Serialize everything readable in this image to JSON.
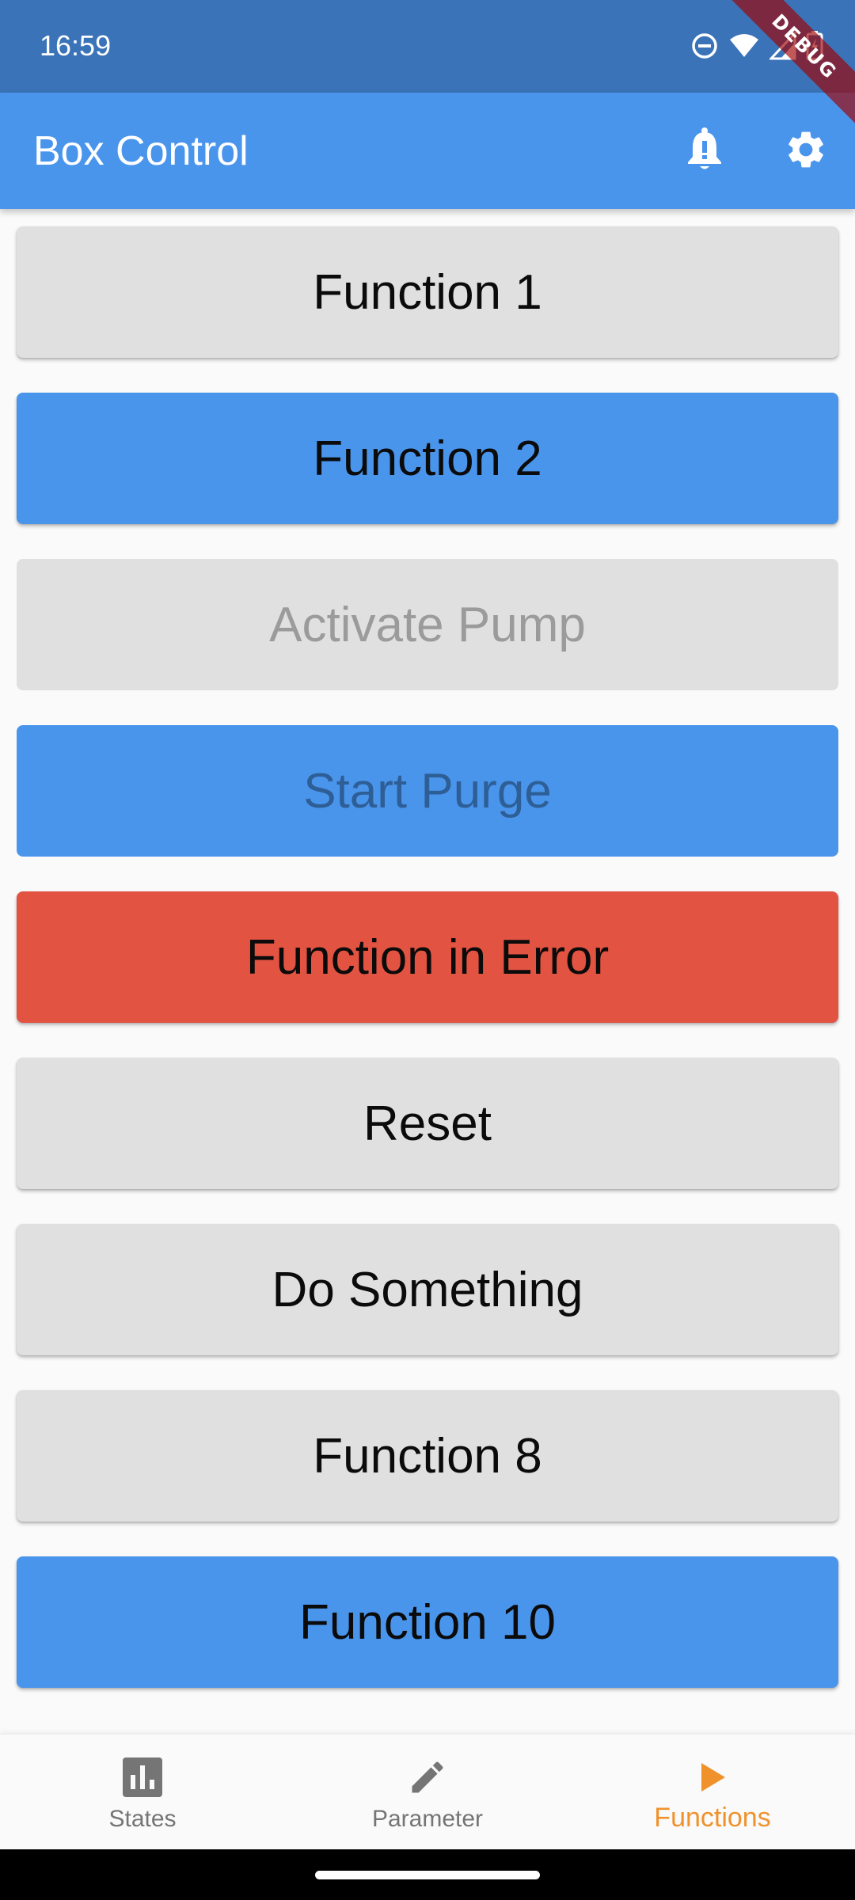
{
  "status_bar": {
    "time": "16:59",
    "icons": [
      "do-not-disturb-icon",
      "wifi-icon",
      "cell-signal-icon",
      "battery-charging-icon"
    ]
  },
  "debug_banner": "DEBUG",
  "app_bar": {
    "title": "Box Control",
    "actions": [
      "bell-icon",
      "gear-icon"
    ]
  },
  "functions": [
    {
      "label": "Function 1",
      "state": "default"
    },
    {
      "label": "Function 2",
      "state": "active"
    },
    {
      "label": "Activate Pump",
      "state": "disabled"
    },
    {
      "label": "Start Purge",
      "state": "active-disabled"
    },
    {
      "label": "Function in Error",
      "state": "error"
    },
    {
      "label": "Reset",
      "state": "default"
    },
    {
      "label": "Do Something",
      "state": "default"
    },
    {
      "label": "Function 8",
      "state": "default"
    },
    {
      "label": "Function 10",
      "state": "active"
    }
  ],
  "bottom_nav": {
    "items": [
      {
        "label": "States",
        "icon": "bar-chart-icon"
      },
      {
        "label": "Parameter",
        "icon": "pencil-icon"
      },
      {
        "label": "Functions",
        "icon": "play-icon"
      }
    ],
    "active_index": 2
  },
  "colors": {
    "status_bar": "#3a73b8",
    "app_bar": "#4a95ec",
    "button_default": "#e0e0e0",
    "button_active": "#4a95ec",
    "button_error": "#e25341",
    "nav_active": "#f0922c",
    "nav_inactive": "#757575"
  }
}
